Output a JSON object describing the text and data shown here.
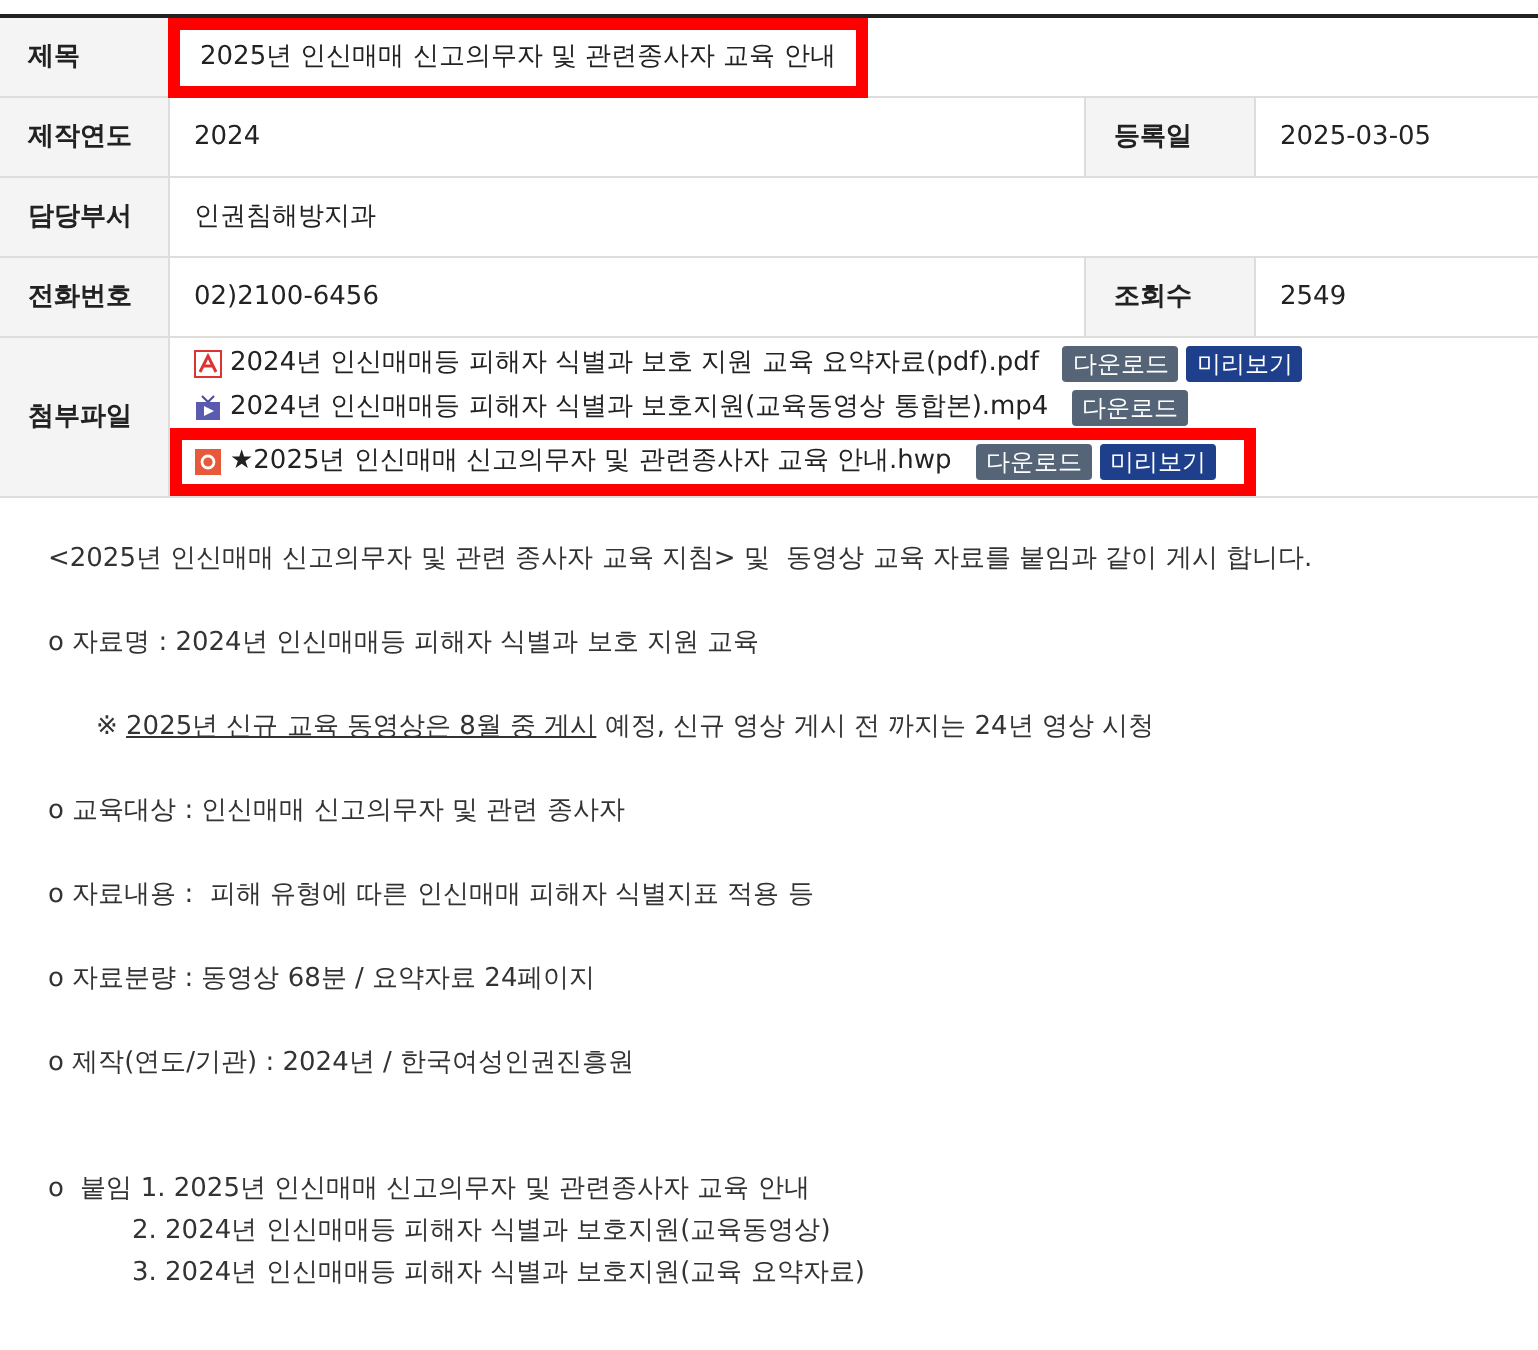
{
  "title_row": {
    "label": "제목",
    "value": "2025년 인신매매 신고의무자 및 관련종사자 교육 안내",
    "highlighted": true
  },
  "info_rows": [
    {
      "cells": [
        {
          "label": "제작연도",
          "value": "2024"
        },
        {
          "label": "등록일",
          "value": "2025-03-05"
        }
      ]
    },
    {
      "cells": [
        {
          "label": "담당부서",
          "value": "인권침해방지과"
        }
      ]
    },
    {
      "cells": [
        {
          "label": "전화번호",
          "value": "02)2100-6456"
        },
        {
          "label": "조회수",
          "value": "2549"
        }
      ]
    }
  ],
  "attachments": {
    "label": "첨부파일",
    "files": [
      {
        "kind": "pdf",
        "name": "2024년 인신매매등 피해자 식별과 보호 지원 교육 요약자료(pdf).pdf",
        "highlighted": false,
        "buttons": [
          {
            "kind": "download",
            "label": "다운로드"
          },
          {
            "kind": "preview",
            "label": "미리보기"
          }
        ]
      },
      {
        "kind": "video",
        "name": "2024년 인신매매등 피해자 식별과 보호지원(교육동영상 통합본).mp4",
        "highlighted": false,
        "buttons": [
          {
            "kind": "download",
            "label": "다운로드"
          }
        ]
      },
      {
        "kind": "hwp",
        "name": "★2025년 인신매매 신고의무자 및 관련종사자 교육 안내.hwp",
        "highlighted": true,
        "buttons": [
          {
            "kind": "download",
            "label": "다운로드"
          },
          {
            "kind": "preview",
            "label": "미리보기"
          }
        ]
      }
    ]
  },
  "body": [
    {
      "kind": "intro",
      "text": "<2025년 인신매매 신고의무자 및 관련 종사자 교육 지침> 및  동영상 교육 자료를 붙임과 같이 게시 합니다."
    },
    {
      "kind": "bullet",
      "text": "o 자료명 : 2024년 인신매매등 피해자 식별과 보호 지원 교육"
    },
    {
      "kind": "note",
      "prefix": "※ ",
      "underlined": "2025년 신규 교육 동영상은 8월 중 게시",
      "text": " 예정, 신규 영상 게시 전 까지는 24년 영상 시청"
    },
    {
      "kind": "bullet",
      "text": "o 교육대상 : 인신매매 신고의무자 및 관련 종사자"
    },
    {
      "kind": "bullet",
      "text": "o 자료내용 :  피해 유형에 따른 인신매매 피해자 식별지표 적용 등"
    },
    {
      "kind": "bullet",
      "text": "o 자료분량 : 동영상 68분 / 요약자료 24페이지"
    },
    {
      "kind": "bullet",
      "text": "o 제작(연도/기관) : 2024년 / 한국여성인권진흥원"
    },
    {
      "kind": "attach",
      "text": "o  붙임 1. 2025년 인신매매 신고의무자 및 관련종사자 교육 안내"
    },
    {
      "kind": "sub",
      "text": "2. 2024년 인신매매등 피해자 식별과 보호지원(교육동영상)"
    },
    {
      "kind": "sub",
      "text": "3. 2024년 인신매매등 피해자 식별과 보호지원(교육 요약자료)"
    }
  ]
}
